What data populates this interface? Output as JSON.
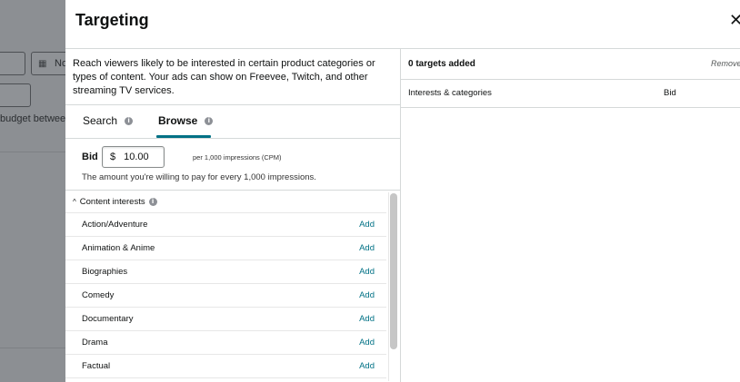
{
  "background": {
    "date_button_label": "No",
    "budget_text": "budget between"
  },
  "modal": {
    "title": "Targeting",
    "close_glyph": "✕"
  },
  "left": {
    "description": "Reach viewers likely to be interested in certain product categories or types of content. Your ads can show on Freevee, Twitch, and other streaming TV services.",
    "tabs": [
      {
        "label": "Search",
        "active": false
      },
      {
        "label": "Browse",
        "active": true
      }
    ],
    "bid": {
      "label": "Bid",
      "currency": "$",
      "value": "10.00",
      "unit": "per 1,000 impressions (CPM)",
      "help": "The amount you're willing to pay for every 1,000 impressions."
    },
    "section": {
      "label": "Content interests",
      "expanded": true
    },
    "add_label": "Add",
    "items": [
      "Action/Adventure",
      "Animation & Anime",
      "Biographies",
      "Comedy",
      "Documentary",
      "Drama",
      "Factual"
    ]
  },
  "right": {
    "count_label": "0 targets added",
    "remove_all_label": "Remove all",
    "columns": {
      "interests": "Interests & categories",
      "bid": "Bid"
    }
  },
  "colors": {
    "link": "#007185",
    "border": "#d5d9d9",
    "overlay": "#8c8f93"
  },
  "icons": {
    "info": "info-icon",
    "calendar": "calendar-icon",
    "chevron": "chevron-up-icon",
    "close": "close-icon"
  }
}
